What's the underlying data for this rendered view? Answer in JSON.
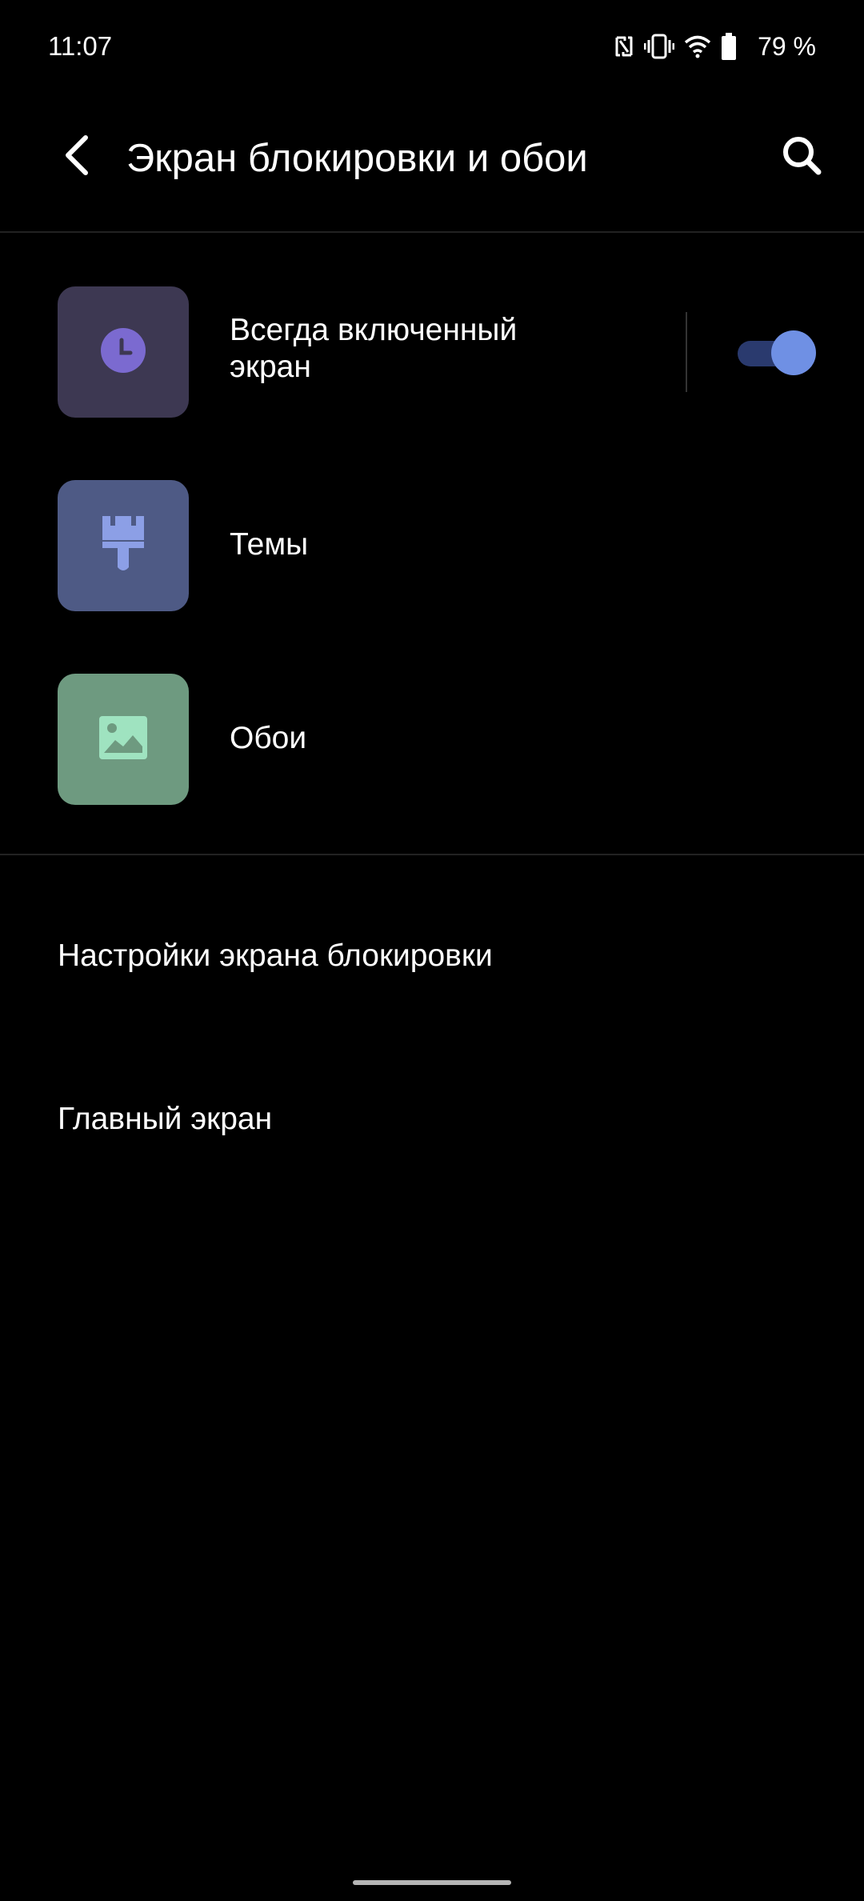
{
  "status_bar": {
    "time": "11:07",
    "icons": [
      "nfc-icon",
      "vibrate-icon",
      "wifi-icon",
      "battery-icon"
    ],
    "battery_text": "79 %"
  },
  "app_bar": {
    "title": "Экран блокировки и обои",
    "back_icon": "back-arrow-icon",
    "search_icon": "search-icon"
  },
  "items": [
    {
      "label_line1": "Всегда включенный",
      "label_line2": "экран",
      "icon": "clock-icon",
      "icon_bg": "#3d3852",
      "icon_fg": "#7b6ad0",
      "toggle_on": true
    },
    {
      "label": "Темы",
      "icon": "paintbrush-icon",
      "icon_bg": "#4e5a85",
      "icon_fg": "#8c9fe6"
    },
    {
      "label": "Обои",
      "icon": "image-icon",
      "icon_bg": "#6e9a80",
      "icon_fg": "#9fe3c0"
    }
  ],
  "settings": [
    {
      "label": "Настройки экрана блокировки"
    },
    {
      "label": "Главный экран"
    }
  ],
  "colors": {
    "background": "#000000",
    "toggle_track": "#2a3a6e",
    "toggle_thumb": "#6f90e4",
    "divider": "#222222"
  }
}
